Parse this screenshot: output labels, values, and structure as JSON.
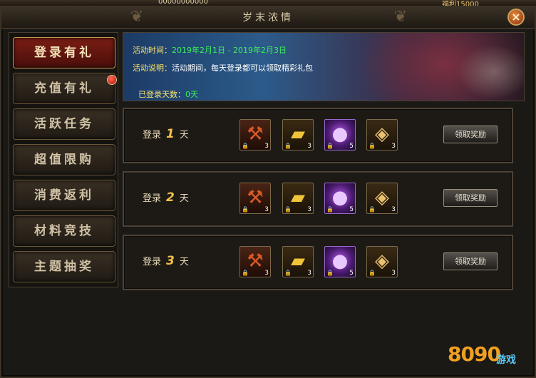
{
  "topstrip": {
    "left_text": "00000000000",
    "right_text": "福利15000"
  },
  "window": {
    "title": "岁末浓情",
    "close_glyph": "×"
  },
  "menu": {
    "items": [
      {
        "label": "登录有礼",
        "active": true
      },
      {
        "label": "充值有礼",
        "active": false
      },
      {
        "label": "活跃任务",
        "active": false
      },
      {
        "label": "超值限购",
        "active": false
      },
      {
        "label": "消费返利",
        "active": false
      },
      {
        "label": "材料竞技",
        "active": false
      },
      {
        "label": "主题抽奖",
        "active": false
      }
    ]
  },
  "banner": {
    "time_label": "活动时间：",
    "time_value": "2019年2月1日 - 2019年2月3日",
    "desc_label": "活动说明：",
    "desc_value": "活动期间，每天登录都可以领取精彩礼包",
    "days_label": "已登录天数：",
    "days_value": "0天"
  },
  "rewards": [
    {
      "prefix": "登录",
      "day": "1",
      "suffix": "天",
      "items": [
        {
          "icon": "axe-icon",
          "count": "3"
        },
        {
          "icon": "gold-bar-icon",
          "count": "3"
        },
        {
          "icon": "purple-orb-icon",
          "count": "5"
        },
        {
          "icon": "talisman-icon",
          "count": "3"
        }
      ],
      "button": "领取奖励"
    },
    {
      "prefix": "登录",
      "day": "2",
      "suffix": "天",
      "items": [
        {
          "icon": "axe-icon",
          "count": "3"
        },
        {
          "icon": "gold-bar-icon",
          "count": "3"
        },
        {
          "icon": "purple-orb-icon",
          "count": "5"
        },
        {
          "icon": "talisman-icon",
          "count": "3"
        }
      ],
      "button": "领取奖励"
    },
    {
      "prefix": "登录",
      "day": "3",
      "suffix": "天",
      "items": [
        {
          "icon": "axe-icon",
          "count": "3"
        },
        {
          "icon": "gold-bar-icon",
          "count": "3"
        },
        {
          "icon": "purple-orb-icon",
          "count": "5"
        },
        {
          "icon": "talisman-icon",
          "count": "3"
        }
      ],
      "button": "领取奖励"
    }
  ],
  "watermark": {
    "brand": "8090",
    "suffix": "游戏"
  },
  "colors": {
    "accent_gold": "#f0c24a",
    "label_yellow": "#ffe36a",
    "value_green": "#3cf05a",
    "active_red": "#7a1e14"
  }
}
